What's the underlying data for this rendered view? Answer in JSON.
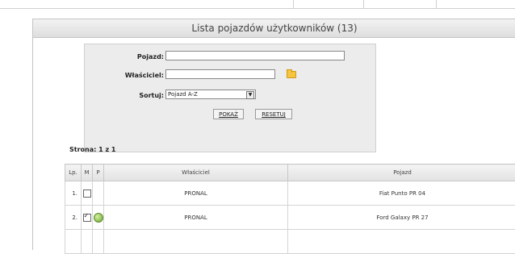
{
  "header": {
    "title": "Lista pojazdów użytkowników (13)"
  },
  "filter": {
    "vehicle_label": "Pojazd:",
    "vehicle_value": "",
    "owner_label": "Właściciel:",
    "owner_value": "",
    "sort_label": "Sortuj:",
    "sort_value": "Pojazd A-Z",
    "show_button": "POKAŻ",
    "reset_button": "RESETUJ"
  },
  "pagination": {
    "text": "Strona: 1 z 1"
  },
  "table": {
    "columns": [
      "Lp.",
      "M",
      "P",
      "Właściciel",
      "Pojazd"
    ],
    "rows": [
      {
        "num": "1.",
        "m_checked": false,
        "p_icon": false,
        "owner": "PRONAL",
        "vehicle": "Fiat Punto PR 04"
      },
      {
        "num": "2.",
        "m_checked": true,
        "p_icon": true,
        "owner": "PRONAL",
        "vehicle": "Ford Galaxy PR 27"
      }
    ]
  },
  "icons": {
    "folder": "folder-icon",
    "photo": "photo-icon",
    "dropdown": "chevron-down-icon"
  }
}
